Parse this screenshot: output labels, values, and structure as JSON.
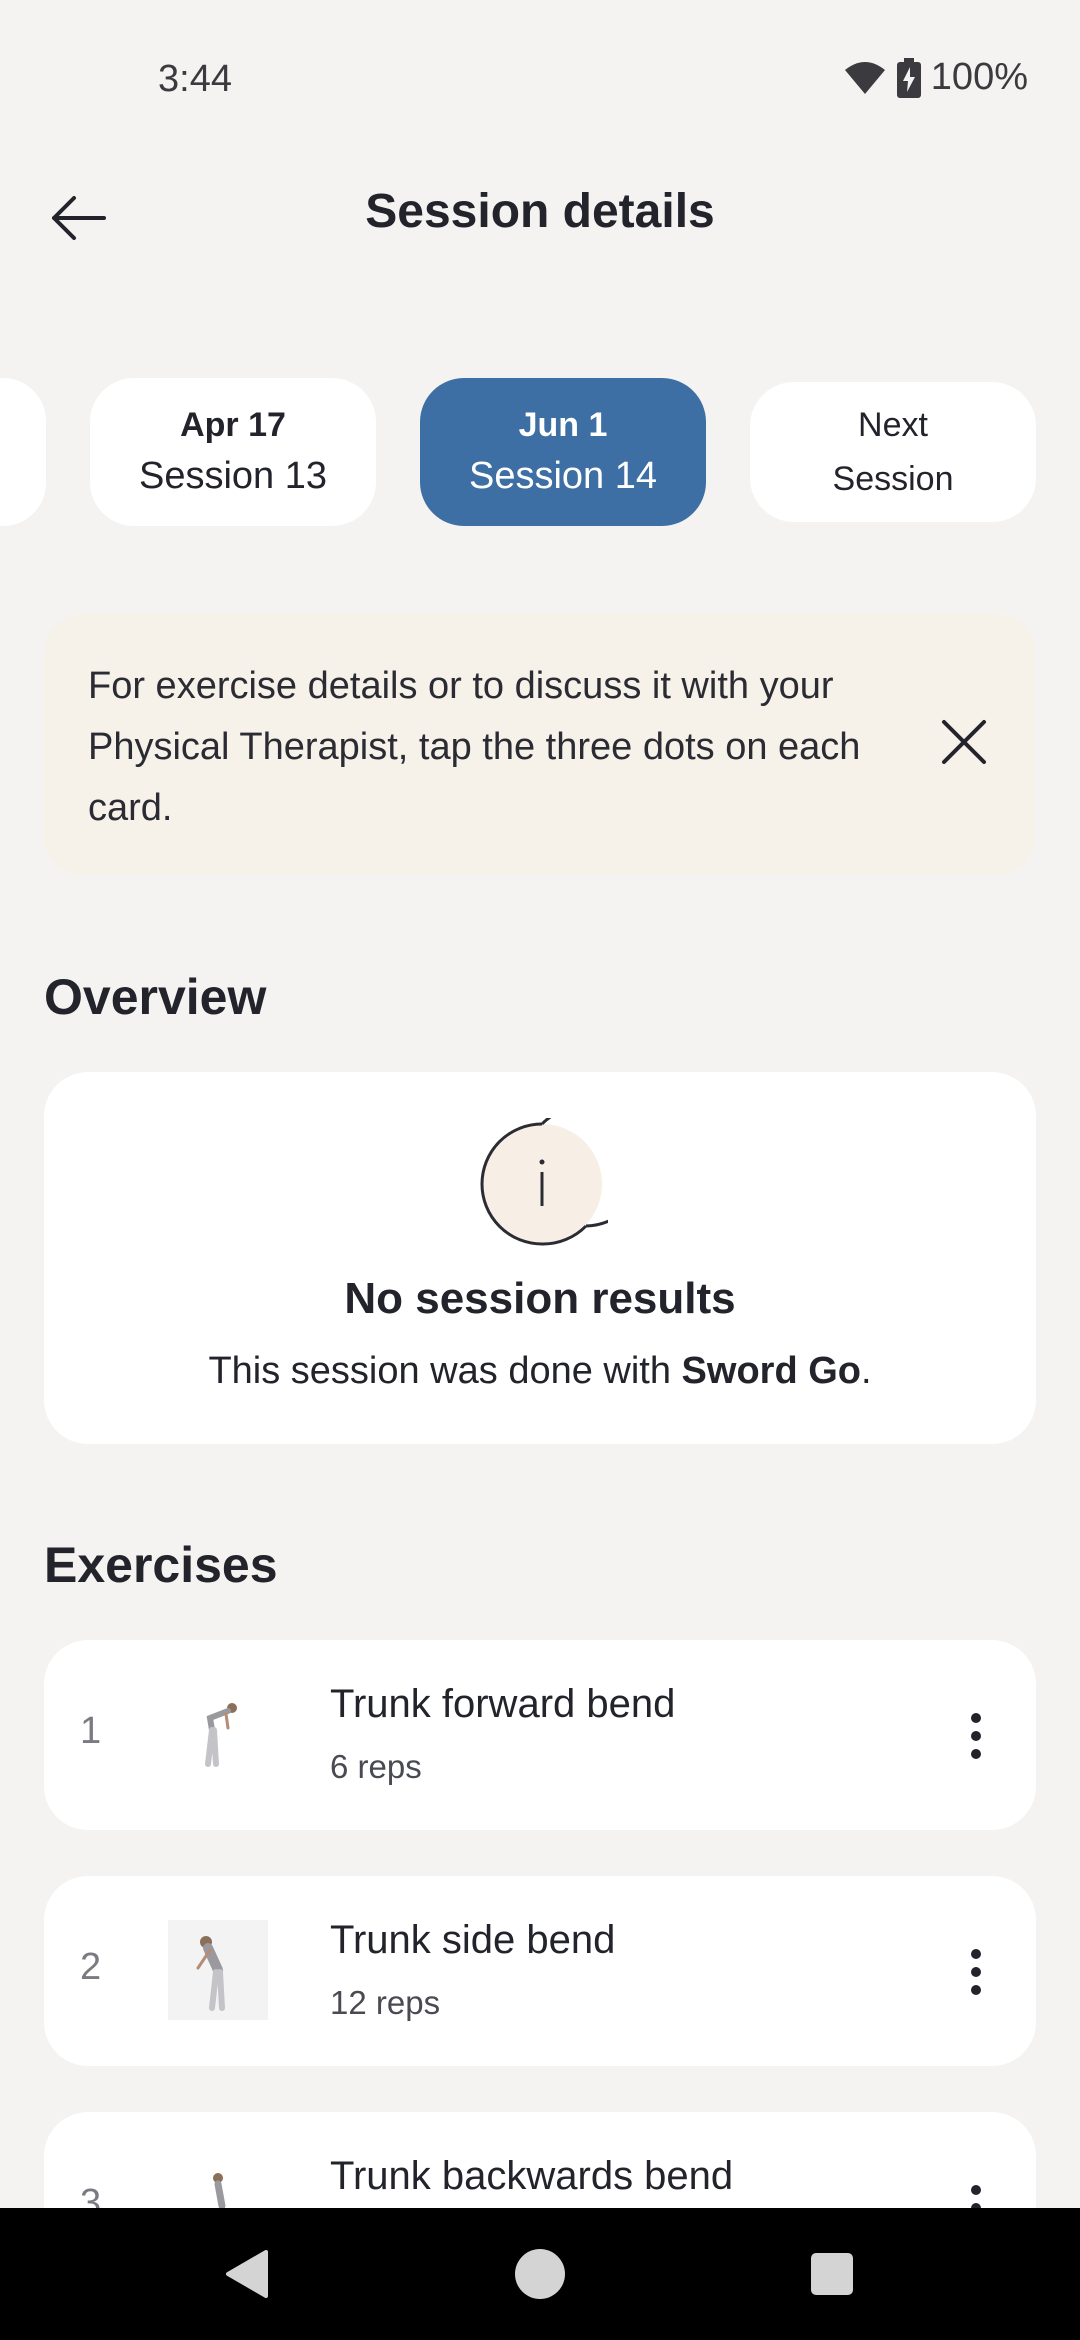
{
  "status_bar": {
    "time": "3:44",
    "battery": "100%",
    "icons": [
      "wifi-icon",
      "battery-charging-icon"
    ]
  },
  "header": {
    "title": "Session details",
    "back_icon": "arrow-left-icon"
  },
  "sessions": {
    "previous_edge": "",
    "items": [
      {
        "date": "Apr 17",
        "label": "Session 13",
        "selected": false
      },
      {
        "date": "Jun 1",
        "label": "Session 14",
        "selected": true
      }
    ],
    "next": {
      "line1": "Next",
      "line2": "Session"
    }
  },
  "banner": {
    "text": "For exercise details or to discuss it with your Physical Therapist, tap the three dots on each card.",
    "close_icon": "close-icon"
  },
  "overview": {
    "heading": "Overview",
    "icon": "info-icon",
    "title": "No session results",
    "subtitle_prefix": "This session was done with ",
    "subtitle_bold": "Sword Go",
    "subtitle_suffix": "."
  },
  "exercises": {
    "heading": "Exercises",
    "items": [
      {
        "index": "1",
        "name": "Trunk forward bend",
        "reps": "6 reps"
      },
      {
        "index": "2",
        "name": "Trunk side bend",
        "reps": "12 reps"
      },
      {
        "index": "3",
        "name": "Trunk backwards bend",
        "reps": ""
      }
    ],
    "more_icon": "more-vertical-icon"
  },
  "nav_bar": {
    "icons": [
      "nav-back-icon",
      "nav-home-icon",
      "nav-recents-icon"
    ]
  },
  "colors": {
    "accent": "#3d6ea4",
    "background": "#f4f3f1",
    "banner": "#f6f1e9",
    "text": "#22232b"
  }
}
